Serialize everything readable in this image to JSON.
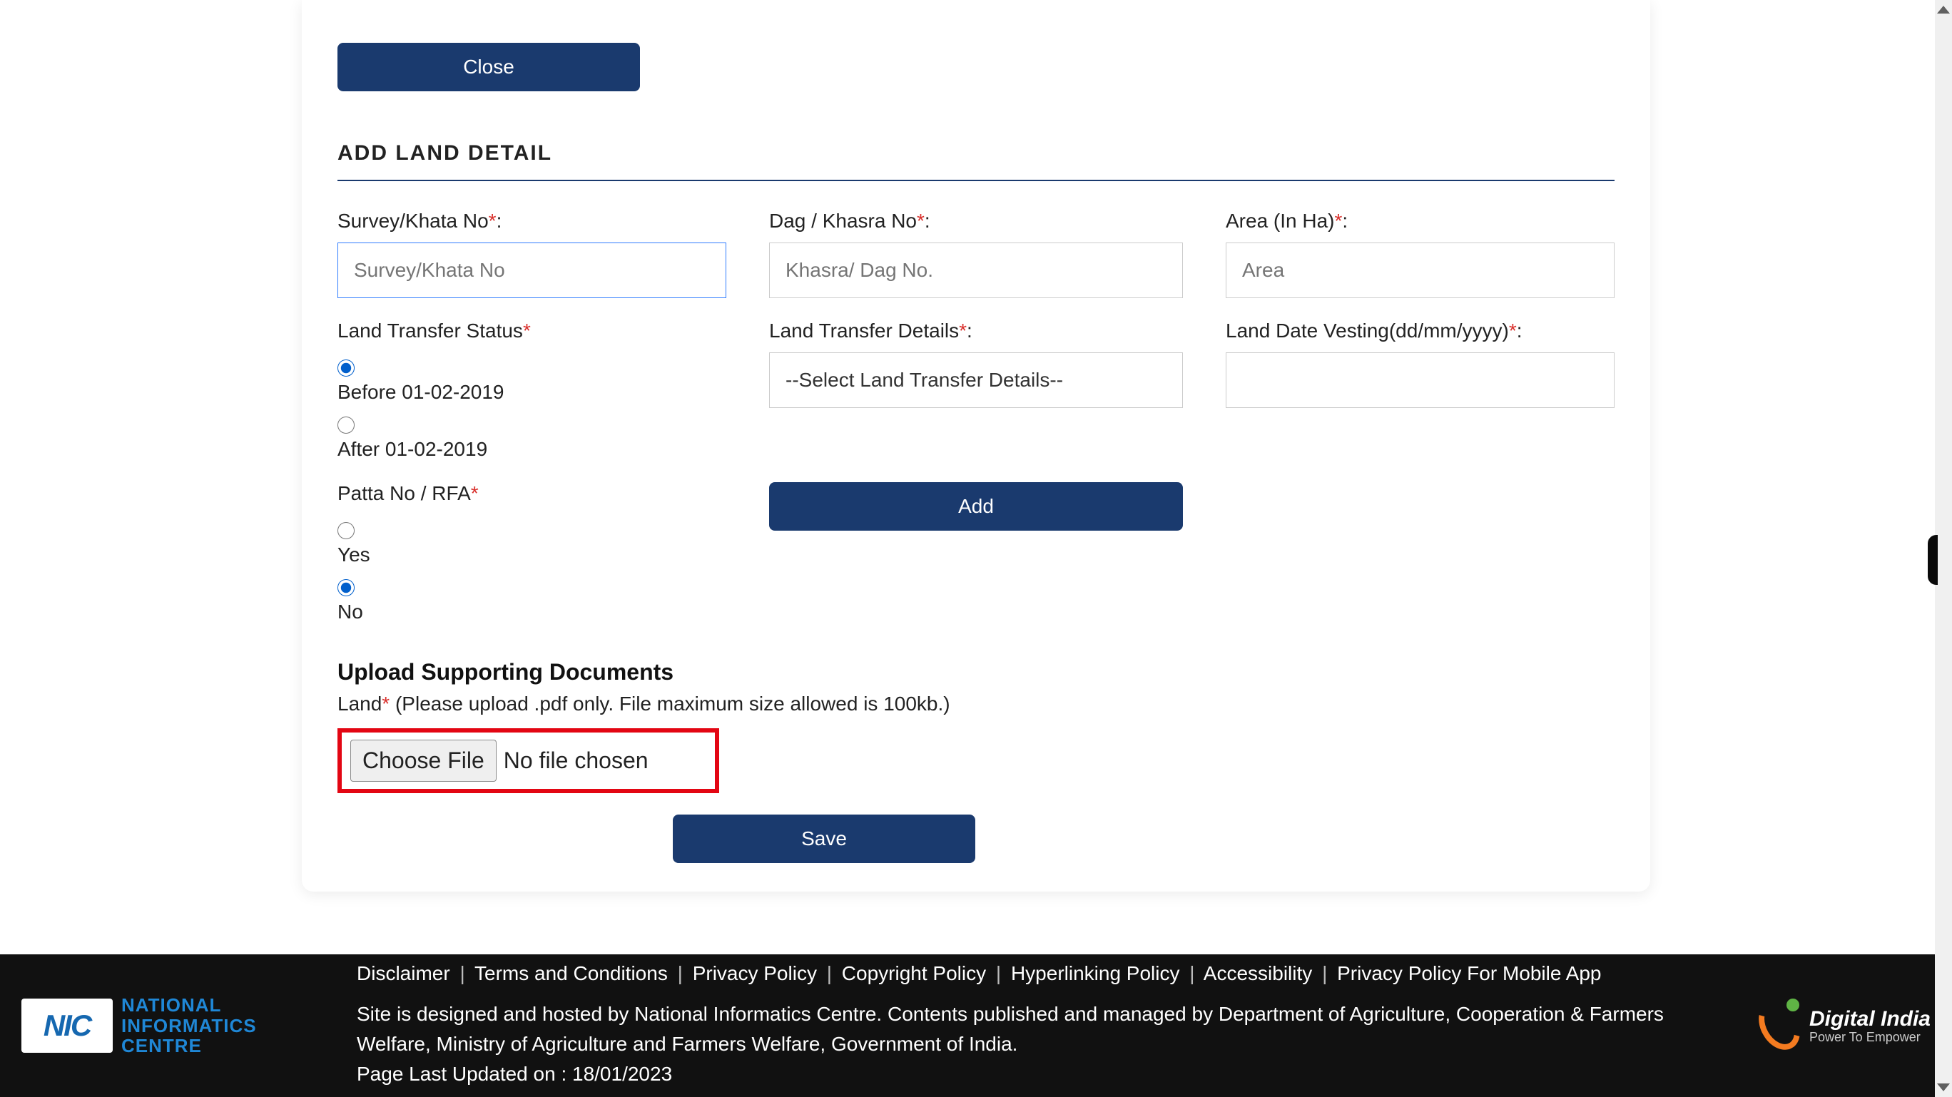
{
  "buttons": {
    "close": "Close",
    "add": "Add",
    "save": "Save"
  },
  "section_title": "ADD LAND DETAIL",
  "fields": {
    "survey_no": {
      "label": "Survey/Khata No",
      "placeholder": "Survey/Khata No"
    },
    "khasra_no": {
      "label": "Dag / Khasra No",
      "placeholder": "Khasra/ Dag No."
    },
    "area": {
      "label": "Area (In Ha)",
      "placeholder": "Area"
    },
    "transfer_status": {
      "label": "Land Transfer Status",
      "options": {
        "before": "Before 01-02-2019",
        "after": "After 01-02-2019"
      },
      "selected": "before"
    },
    "transfer_details": {
      "label": "Land Transfer Details",
      "selected_text": "--Select Land Transfer Details--"
    },
    "date_vesting": {
      "label": "Land Date Vesting(dd/mm/yyyy)"
    },
    "patta": {
      "label": "Patta No / RFA",
      "options": {
        "yes": "Yes",
        "no": "No"
      },
      "selected": "no"
    }
  },
  "upload": {
    "heading": "Upload Supporting Documents",
    "label": "Land",
    "hint": " (Please upload .pdf only. File maximum size allowed is 100kb.)",
    "choose_btn": "Choose File",
    "no_file": "No file chosen"
  },
  "footer": {
    "nic": {
      "box": "NIC",
      "line1": "NATIONAL",
      "line2": "INFORMATICS",
      "line3": "CENTRE"
    },
    "links": [
      "Disclaimer",
      "Terms and Conditions",
      "Privacy Policy",
      "Copyright Policy",
      "Hyperlinking Policy",
      "Accessibility",
      "Privacy Policy For Mobile App"
    ],
    "disclaimer_line1": "Site is designed and hosted by National Informatics Centre. Contents published and managed by Department of Agriculture, Cooperation & Farmers Welfare, Ministry of Agriculture and Farmers Welfare, Government of India.",
    "last_updated": "Page Last Updated on : 18/01/2023",
    "digital_india": {
      "title": "Digital India",
      "sub": "Power To Empower"
    }
  }
}
